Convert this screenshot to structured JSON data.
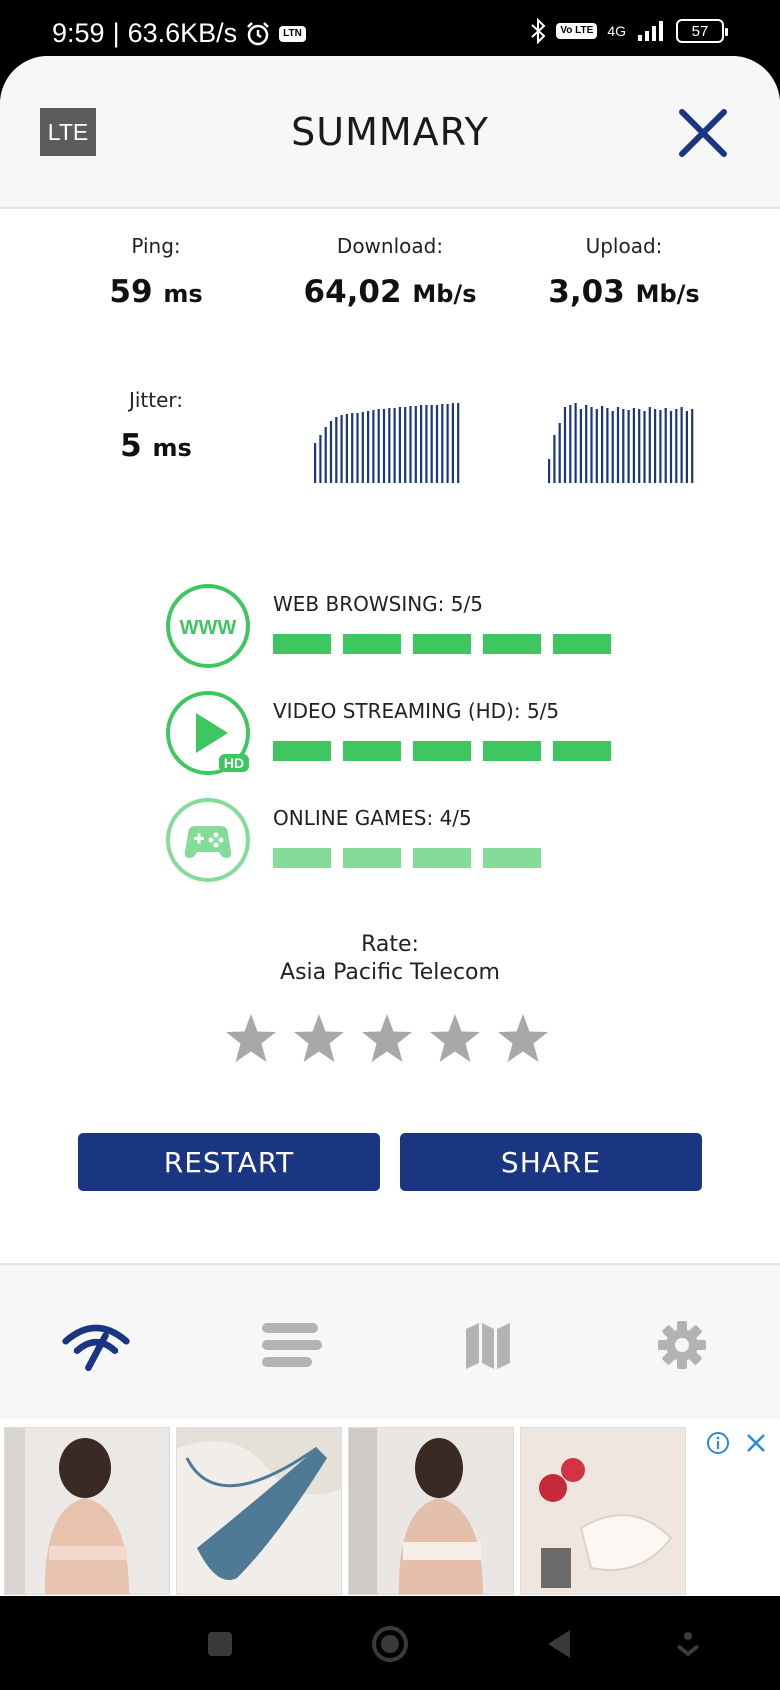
{
  "status_bar": {
    "time": "9:59",
    "separator": "|",
    "network_speed": "63.6KB/s",
    "alarm_icon": "alarm-icon",
    "ltn_badge": "LTN",
    "volte_badge": "Vo LTE",
    "network_type": "4G",
    "battery_level": "57"
  },
  "header": {
    "network_badge": "LTE",
    "title": "SUMMARY",
    "close_icon": "close-icon"
  },
  "metrics": {
    "ping": {
      "label": "Ping:",
      "value": "59",
      "unit": "ms"
    },
    "download": {
      "label": "Download:",
      "value": "64,02",
      "unit": "Mb/s"
    },
    "upload": {
      "label": "Upload:",
      "value": "3,03",
      "unit": "Mb/s"
    },
    "jitter": {
      "label": "Jitter:",
      "value": "5",
      "unit": "ms"
    }
  },
  "graphs": {
    "color": "#1a3682",
    "download_levels": [
      0.5,
      0.6,
      0.7,
      0.78,
      0.82,
      0.85,
      0.86,
      0.87,
      0.88,
      0.89,
      0.9,
      0.91,
      0.92,
      0.93,
      0.94,
      0.94,
      0.95,
      0.95,
      0.96,
      0.96,
      0.97,
      0.97,
      0.98,
      0.98,
      0.99,
      0.99,
      1.0,
      1.0
    ],
    "upload_levels": [
      0.3,
      0.6,
      0.75,
      0.95,
      0.98,
      1.0,
      0.93,
      0.97,
      0.95,
      0.92,
      0.96,
      0.94,
      0.9,
      0.95,
      0.93,
      0.91,
      0.94,
      0.92,
      0.9,
      0.95,
      0.93,
      0.91,
      0.94,
      0.9,
      0.92,
      0.95,
      0.9,
      0.93
    ]
  },
  "quality": [
    {
      "icon": "www-icon",
      "label": "WEB BROWSING: 5/5",
      "score": 5
    },
    {
      "icon": "video-hd-icon",
      "label": "VIDEO STREAMING (HD): 5/5",
      "score": 5,
      "badge": "HD"
    },
    {
      "icon": "gamepad-icon",
      "label": "ONLINE GAMES: 4/5",
      "score": 4
    }
  ],
  "quality_icon_text": {
    "www": "WWW",
    "hd": "HD"
  },
  "rate": {
    "label": "Rate:",
    "provider": "Asia Pacific Telecom",
    "stars_total": 5,
    "stars_selected": 0
  },
  "buttons": {
    "restart": "RESTART",
    "share": "SHARE"
  },
  "colors": {
    "accent": "#1a3682",
    "green": "#3ec760",
    "green_light": "#84dc98",
    "star": "#a8a8a8"
  },
  "bottom_nav": [
    {
      "icon": "speed-test-icon",
      "active": true
    },
    {
      "icon": "history-list-icon",
      "active": false
    },
    {
      "icon": "map-icon",
      "active": false
    },
    {
      "icon": "settings-gear-icon",
      "active": false
    }
  ],
  "ad": {
    "images": [
      "lingerie-back-photo",
      "blue-lace-panty-photo",
      "bra-back-photo",
      "white-lace-roses-photo"
    ],
    "info_icon": "ad-info-icon",
    "close_icon": "ad-close-icon"
  }
}
